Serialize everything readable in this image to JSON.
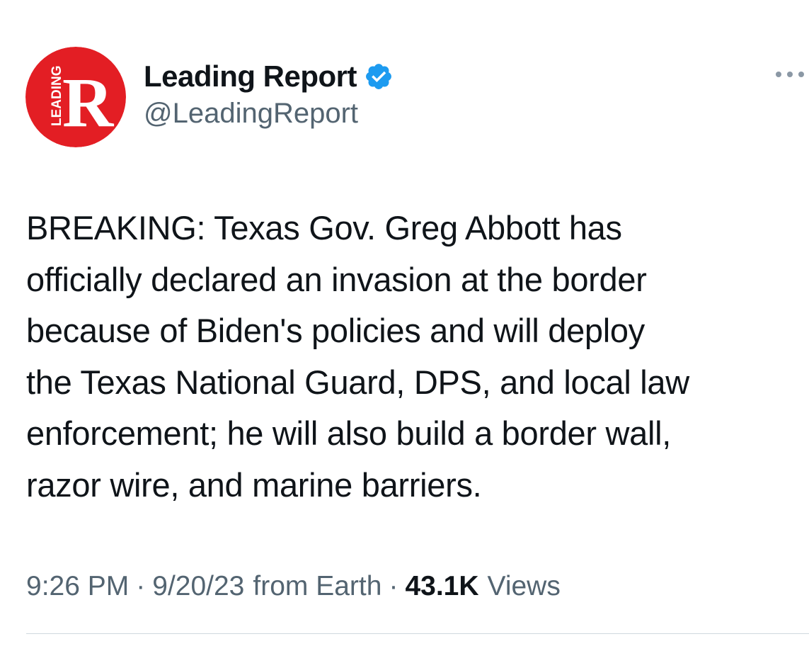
{
  "author": {
    "name": "Leading Report",
    "handle": "@LeadingReport",
    "avatar_letter": "R",
    "avatar_text": "LEADING",
    "avatar_color": "#e31e24",
    "verified_color": "#1d9bf0"
  },
  "tweet": {
    "lines": [
      "BREAKING: Texas Gov. Greg Abbott has",
      "officially declared an invasion at the border",
      "because of Biden's policies and will deploy",
      "the Texas National Guard, DPS, and local law",
      "enforcement; he will also build a border wall,",
      "razor wire, and marine barriers."
    ]
  },
  "meta": {
    "time": "9:26 PM",
    "date": "9/20/23",
    "source": "from Earth",
    "separator": "·",
    "views_count": "43.1K",
    "views_label": "Views"
  },
  "icons": {
    "more": "more-icon",
    "verified": "verified-badge-icon"
  }
}
